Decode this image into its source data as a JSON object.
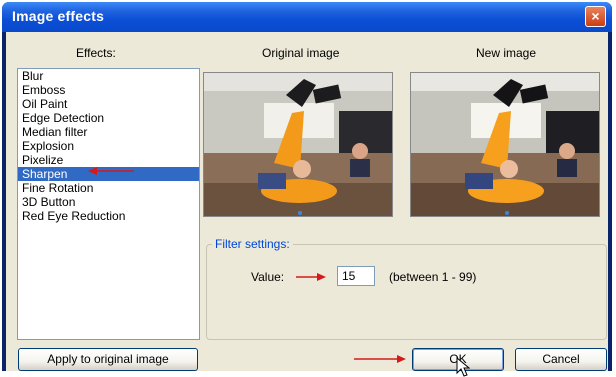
{
  "window": {
    "title": "Image effects",
    "close_glyph": "×"
  },
  "effects": {
    "label": "Effects:",
    "items": [
      "Blur",
      "Emboss",
      "Oil Paint",
      "Edge Detection",
      "Median filter",
      "Explosion",
      "Pixelize",
      "Sharpen",
      "Fine Rotation",
      "3D Button",
      "Red Eye Reduction"
    ],
    "selected_index": 7
  },
  "preview": {
    "original_label": "Original image",
    "new_label": "New image"
  },
  "filter": {
    "group_label": "Filter settings:",
    "value_label": "Value:",
    "value": "15",
    "range_hint": "(between 1 - 99)"
  },
  "buttons": {
    "apply": "Apply to original image",
    "ok": "OK",
    "cancel": "Cancel"
  },
  "colors": {
    "accent": "#316ac5",
    "annotation_arrow": "#d41a1a",
    "title_bar": "#0b4fd6"
  }
}
